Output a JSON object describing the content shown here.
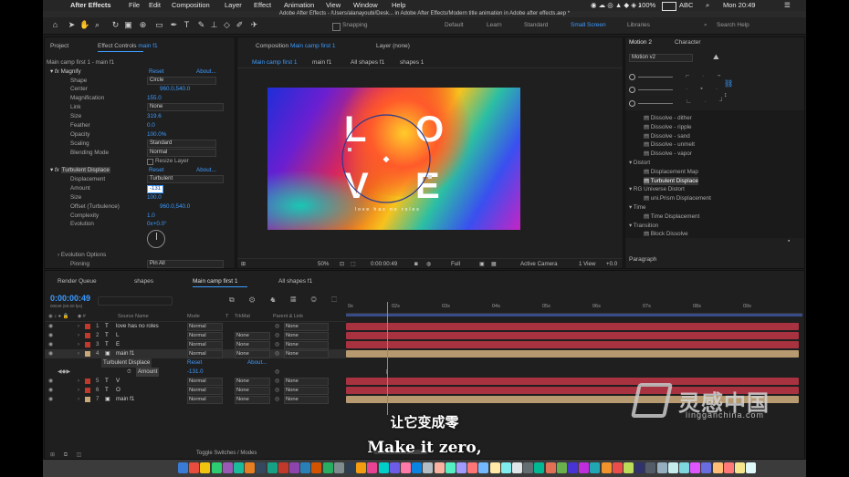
{
  "menubar": {
    "app_name": "After Effects",
    "items": [
      "File",
      "Edit",
      "Composition",
      "Layer",
      "Effect",
      "Animation",
      "View",
      "Window",
      "Help"
    ],
    "battery": "100%",
    "input_label": "ABC",
    "clock": "Mon 20:49"
  },
  "window_title": "Adobe After Effects - /Users/alanayoubi/Desk... in Adobe After Effects/Modern title animation in Adobe after effects.aep *",
  "toolbar": {
    "snapping": "Snapping",
    "workspaces": [
      "Default",
      "Learn",
      "Standard",
      "Small Screen",
      "Libraries"
    ],
    "search_placeholder": "Search Help"
  },
  "project_panel": {
    "tab_project": "Project",
    "tab_effect_controls": "Effect Controls",
    "ec_layer": "main f1",
    "breadcrumb": "Main camp first 1 - main f1",
    "magnify": {
      "name": "Magnify",
      "reset": "Reset",
      "about": "About...",
      "shape_label": "Shape",
      "shape_value": "Circle",
      "center_label": "Center",
      "center_value": "960.0,540.0",
      "magnification_label": "Magnification",
      "magnification_value": "155.0",
      "link_label": "Link",
      "link_value": "None",
      "size_label": "Size",
      "size_value": "319.6",
      "feather_label": "Feather",
      "feather_value": "0.0",
      "opacity_label": "Opacity",
      "opacity_value": "100.0%",
      "scaling_label": "Scaling",
      "scaling_value": "Standard",
      "blending_label": "Blending Mode",
      "blending_value": "Normal",
      "resize_label": "Resize Layer"
    },
    "turbulent": {
      "name": "Turbulent Displace",
      "reset": "Reset",
      "about": "About...",
      "displacement_label": "Displacement",
      "displacement_value": "Turbulent",
      "amount_label": "Amount",
      "amount_value": "-131",
      "size_label": "Size",
      "size_value": "100.0",
      "offset_label": "Offset (Turbulence)",
      "offset_value": "960.0,540.0",
      "complexity_label": "Complexity",
      "complexity_value": "1.0",
      "evolution_label": "Evolution",
      "evolution_value": "0x+0.0°",
      "evolution_options_label": "Evolution Options",
      "pinning_label": "Pinning",
      "pinning_value": "Pin All"
    }
  },
  "composition_panel": {
    "tab_label": "Composition",
    "comp_name": "Main camp first 1",
    "layer_tab": "Layer (none)",
    "breadcrumbs": [
      "Main camp first 1",
      "main f1",
      "All shapes f1",
      "shapes 1"
    ],
    "letters": [
      "L",
      "O",
      "V",
      "E"
    ],
    "tagline": "love has no roles",
    "zoom": "50%",
    "timecode": "0:00:00:49",
    "resolution": "Full",
    "camera": "Active Camera",
    "view": "1 View",
    "extra": "+0.0"
  },
  "right_panel": {
    "tab_motion": "Motion 2",
    "tab_character": "Character",
    "motion_version": "Motion v2",
    "effects_list": [
      {
        "label": "Dissolve - dither",
        "type": "item"
      },
      {
        "label": "Dissolve - ripple",
        "type": "item"
      },
      {
        "label": "Dissolve - sand",
        "type": "item"
      },
      {
        "label": "Dissolve - unmelt",
        "type": "item"
      },
      {
        "label": "Dissolve - vapor",
        "type": "item"
      },
      {
        "label": "Distort",
        "type": "group"
      },
      {
        "label": "Displacement Map",
        "type": "item"
      },
      {
        "label": "Turbulent Displace",
        "type": "item",
        "selected": true
      },
      {
        "label": "RG Universe Distort",
        "type": "group"
      },
      {
        "label": "uni.Prism Displacement",
        "type": "item"
      },
      {
        "label": "Time",
        "type": "group"
      },
      {
        "label": "Time Displacement",
        "type": "item"
      },
      {
        "label": "Transition",
        "type": "group"
      },
      {
        "label": "Block Dissolve",
        "type": "item"
      }
    ],
    "paragraph_tab": "Paragraph"
  },
  "timeline": {
    "tabs": [
      "Render Queue",
      "shapes",
      "Main camp first 1",
      "All shapes f1"
    ],
    "timecode": "0:00:00:49",
    "timecode_sub": "00049 (60.00 fps)",
    "columns": {
      "source": "Source Name",
      "mode": "Mode",
      "t": "T",
      "trkmat": "TrkMat",
      "parent": "Parent & Link"
    },
    "ruler": [
      "0s",
      "02s",
      "03s",
      "04s",
      "05s",
      "06s",
      "07s",
      "08s",
      "09s"
    ],
    "layers": [
      {
        "num": "1",
        "type": "T",
        "name": "love has no roles",
        "mode": "Normal",
        "trkmat": "",
        "parent": "None",
        "color": "#c0392b"
      },
      {
        "num": "2",
        "type": "T",
        "name": "L",
        "mode": "Normal",
        "trkmat": "None",
        "parent": "None",
        "color": "#c0392b"
      },
      {
        "num": "3",
        "type": "T",
        "name": "E",
        "mode": "Normal",
        "trkmat": "None",
        "parent": "None",
        "color": "#c0392b"
      },
      {
        "num": "4",
        "type": "img",
        "name": "main f1",
        "mode": "Normal",
        "trkmat": "None",
        "parent": "None",
        "color": "#c8a878",
        "selected": true
      },
      {
        "num": "5",
        "type": "T",
        "name": "V",
        "mode": "Normal",
        "trkmat": "None",
        "parent": "None",
        "color": "#c0392b"
      },
      {
        "num": "6",
        "type": "T",
        "name": "O",
        "mode": "Normal",
        "trkmat": "None",
        "parent": "None",
        "color": "#c0392b"
      },
      {
        "num": "7",
        "type": "img",
        "name": "main f1",
        "mode": "Normal",
        "trkmat": "None",
        "parent": "None",
        "color": "#c8a878"
      }
    ],
    "effect_row": {
      "name": "Turbulent Displace",
      "reset": "Reset",
      "about": "About..."
    },
    "amount_row": {
      "name": "Amount",
      "value": "-131.0"
    },
    "toggle_label": "Toggle Switches / Modes"
  },
  "subtitle": {
    "chinese": "让它变成零",
    "english": "Make it zero,"
  },
  "watermark": {
    "brand_cn": "灵感中国",
    "url": "lingganchina.com"
  }
}
